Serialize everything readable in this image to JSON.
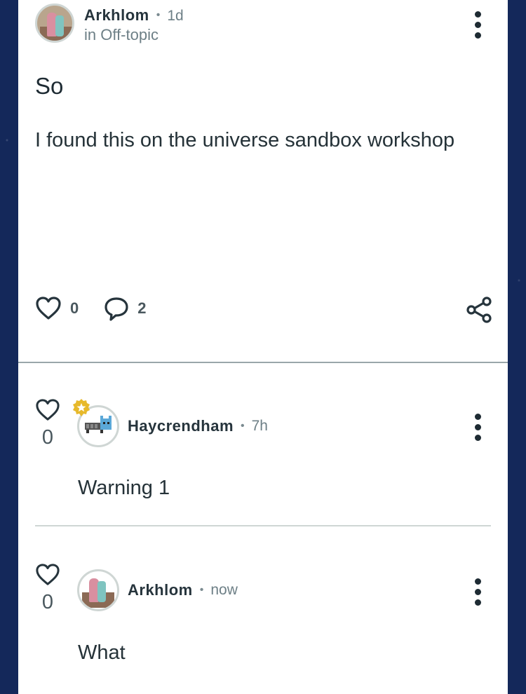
{
  "post": {
    "author": "Arkhlom",
    "time": "1d",
    "community": "in Off-topic",
    "title": "So",
    "body": "I found this on the universe sandbox workshop",
    "likes": "0",
    "comments": "2"
  },
  "comments": [
    {
      "likes": "0",
      "author": "Haycrendham",
      "time": "7h",
      "text": "Warning 1"
    },
    {
      "likes": "0",
      "author": "Arkhlom",
      "time": "now",
      "text": "What"
    }
  ],
  "icons": {
    "like": "heart-outline-icon",
    "comment": "speech-bubble-icon",
    "share": "share-nodes-icon",
    "menu": "vertical-dots-icon",
    "badge": "star-badge-icon"
  },
  "colors": {
    "background": "#14285a",
    "panel": "#ffffff",
    "badge": "#e7b92b",
    "text": "#1e2b33"
  }
}
